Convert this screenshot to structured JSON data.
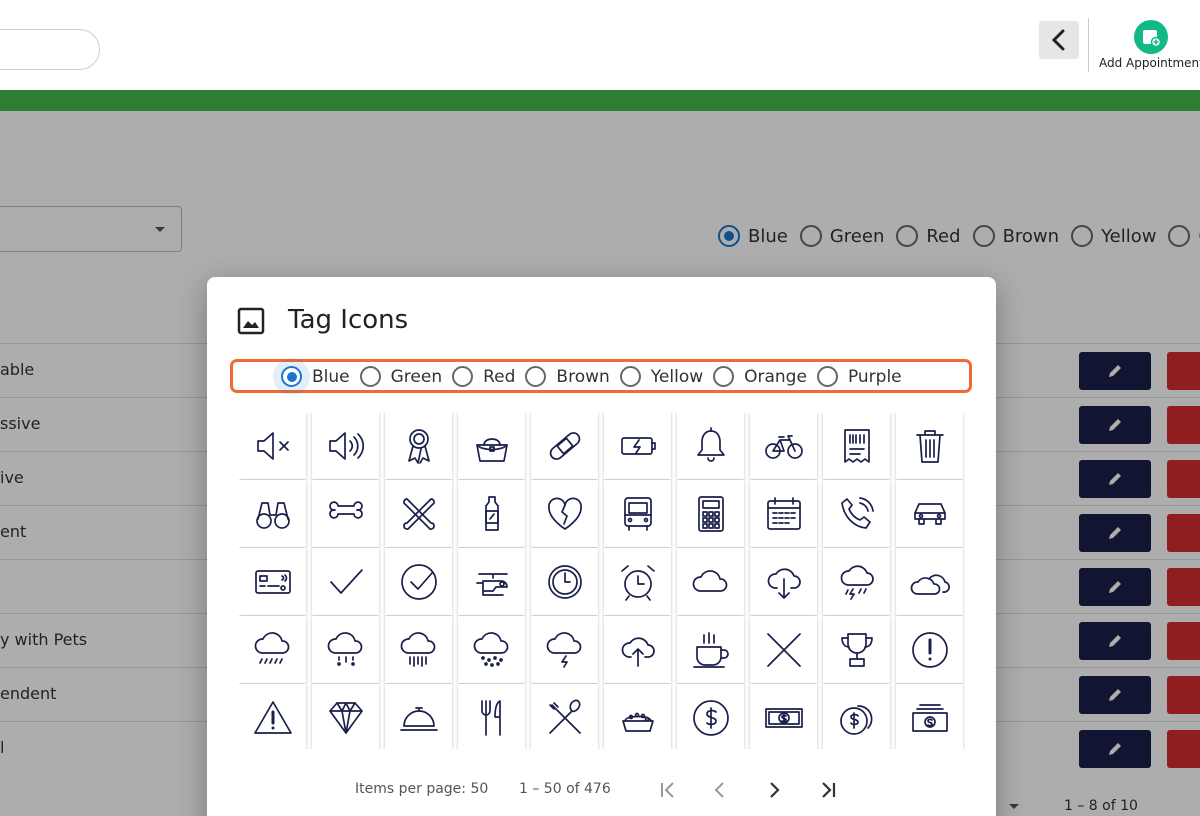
{
  "header": {
    "add_appointment_label": "Add Appointment"
  },
  "background": {
    "color_options": [
      "Blue",
      "Green",
      "Red",
      "Brown",
      "Yellow",
      "O"
    ],
    "selected_color": "Blue",
    "rows": [
      "able",
      "ssive",
      "ive",
      "ent",
      "",
      "y with Pets",
      "endent",
      "l"
    ],
    "pager_range": "1 – 8 of 10"
  },
  "modal": {
    "title": "Tag Icons",
    "color_options": [
      "Blue",
      "Green",
      "Red",
      "Brown",
      "Yellow",
      "Orange",
      "Purple"
    ],
    "selected_color": "Blue",
    "icons": [
      "speaker-mute-icon",
      "speaker-loud-icon",
      "award-ribbon-icon",
      "handbag-icon",
      "bandage-icon",
      "battery-charging-icon",
      "bell-icon",
      "bicycle-icon",
      "receipt-icon",
      "trash-icon",
      "binoculars-icon",
      "bone-icon",
      "crossbones-icon",
      "bottle-icon",
      "broken-heart-icon",
      "bus-icon",
      "calculator-icon",
      "calendar-icon",
      "phone-call-icon",
      "car-icon",
      "credit-card-icon",
      "checkmark-icon",
      "check-circle-icon",
      "helicopter-icon",
      "clock-icon",
      "alarm-clock-icon",
      "cloud-icon",
      "cloud-download-icon",
      "cloud-lightning-rain-icon",
      "clouds-icon",
      "cloud-drizzle-icon",
      "cloud-sleet-icon",
      "cloud-heavy-rain-icon",
      "cloud-snow-icon",
      "cloud-lightning-icon",
      "cloud-upload-icon",
      "coffee-cup-icon",
      "cross-icon",
      "trophy-icon",
      "exclamation-circle-icon",
      "warning-triangle-icon",
      "diamond-icon",
      "food-cloche-icon",
      "fork-knife-icon",
      "spoon-fork-icon",
      "pet-food-bowl-icon",
      "dollar-coin-icon",
      "dollar-bill-icon",
      "dollar-coins-icon",
      "money-stack-icon"
    ],
    "pager": {
      "items_per_page": "Items per page: 50",
      "range": "1 – 50 of 476"
    }
  },
  "colors": {
    "accent_blue": "#1976d2",
    "icon_navy": "#1a1f4b",
    "header_green": "#2e7d32",
    "highlight_orange": "#f06b2f",
    "delete_red": "#d32f2f"
  }
}
